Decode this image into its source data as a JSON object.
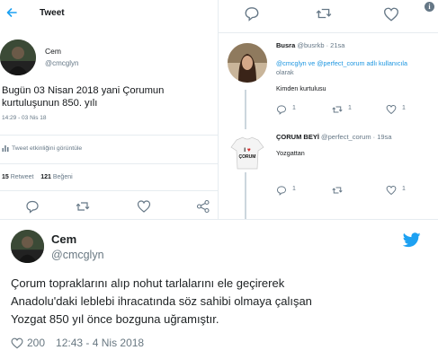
{
  "left_tweet": {
    "header_title": "Tweet",
    "author_name": "Cem",
    "author_handle": "@cmcglyn",
    "text_line1": "Bugün 03 Nisan 2018 yani Çorumun",
    "text_line2": "kurtuluşunun 850. yılı",
    "timestamp": "14:29 - 03 Nis 18",
    "activity_label": "Tweet etkinliğini görüntüle",
    "retweets_count": "15",
    "retweets_label": "Retweet",
    "likes_count": "121",
    "likes_label": "Beğeni"
  },
  "replies": [
    {
      "author_name": "Busra",
      "author_handle": "@busrkb",
      "age": "21sa",
      "mention_line": "@cmcglyn ve @perfect_corum adlı kullanıcıla",
      "context_suffix": "olarak",
      "text": "Kimden kurtulusu",
      "reply_count": "1",
      "retweet_count": "1",
      "like_count": "1"
    },
    {
      "author_name": "ÇORUM BEYİ",
      "author_handle": "@perfect_corum",
      "age": "19sa",
      "text": "Yozgattan",
      "reply_count": "1",
      "retweet_count": "",
      "like_count": "1",
      "shirt_text": "I ♥ ÇORUM"
    }
  ],
  "embed": {
    "author_name": "Cem",
    "author_handle": "@cmcglyn",
    "text_line1": "Çorum topraklarını alıp nohut tarlalarını ele geçirerek",
    "text_line2": "Anadolu'daki leblebi ihracatında söz sahibi olmaya çalışan",
    "text_line3": "Yozgat 850 yıl önce bozguna uğramıştır.",
    "likes": "200",
    "datetime": "12:43 - 4 Nis 2018"
  },
  "colors": {
    "twitter_blue": "#1da1f2",
    "link_blue": "#1b95e0",
    "secondary_text": "#657786",
    "divider": "#e6ecf0"
  },
  "icons": [
    "back-arrow-icon",
    "reply-icon",
    "retweet-icon",
    "heart-icon",
    "share-icon",
    "bar-chart-icon",
    "info-icon",
    "twitter-bird-icon"
  ]
}
